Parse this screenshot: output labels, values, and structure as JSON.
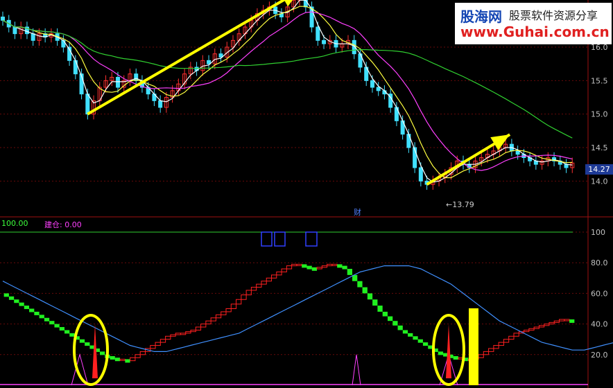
{
  "watermark": {
    "logo": "股海网",
    "tagline": "股票软件资源分享",
    "url": "www.Guhai.com.cn"
  },
  "price_axis": {
    "ticks": [
      "16.0",
      "15.5",
      "15.0",
      "14.5",
      "14.0"
    ],
    "last_price": "14.27"
  },
  "indicator_axis": {
    "ticks": [
      "100",
      "80.0",
      "60.0",
      "40.0",
      "20.0"
    ]
  },
  "labels": {
    "line_a": "100.00",
    "line_b_name": "建仓",
    "line_b_value": "0.00",
    "finance_marker": "财",
    "low_marker": "←13.79"
  },
  "colors": {
    "background": "#000000",
    "candle_up": "#ff3030",
    "candle_down": "#40e0ff",
    "ma_short": "#ffffff",
    "ma_mid": "#ffff40",
    "ma_long": "#ff40ff",
    "ma_trend": "#30d030",
    "arrow": "#ffff00",
    "step_up": "#ff2020",
    "step_down": "#20f020",
    "signal": "#4090ff"
  },
  "chart_data": [
    {
      "type": "candlestick",
      "panel": "price",
      "ylim": [
        13.6,
        16.6
      ],
      "close": [
        16.4,
        16.3,
        16.2,
        16.3,
        16.2,
        16.1,
        16.2,
        16.15,
        16.2,
        16.1,
        16.0,
        15.8,
        15.6,
        15.3,
        15.0,
        15.2,
        15.4,
        15.5,
        15.55,
        15.4,
        15.5,
        15.6,
        15.5,
        15.4,
        15.3,
        15.2,
        15.1,
        15.25,
        15.35,
        15.45,
        15.6,
        15.7,
        15.65,
        15.8,
        15.75,
        15.9,
        15.85,
        16.0,
        16.1,
        16.2,
        16.3,
        16.4,
        16.5,
        16.55,
        16.6,
        16.5,
        16.45,
        16.6,
        16.7,
        16.8,
        16.6,
        16.3,
        16.1,
        16.05,
        16.1,
        16.0,
        16.05,
        16.1,
        15.9,
        15.7,
        15.5,
        15.4,
        15.35,
        15.3,
        15.1,
        14.9,
        14.7,
        14.5,
        14.2,
        14.0,
        13.95,
        14.0,
        14.05,
        14.1,
        14.2,
        14.3,
        14.25,
        14.2,
        14.3,
        14.35,
        14.4,
        14.45,
        14.5,
        14.55,
        14.45,
        14.4,
        14.35,
        14.3,
        14.25,
        14.3,
        14.35,
        14.3,
        14.25,
        14.2,
        14.27
      ],
      "low": 13.79
    },
    {
      "type": "line",
      "panel": "indicator",
      "ylim": [
        0,
        100
      ],
      "series": [
        {
          "values": [
            60,
            58,
            56,
            54,
            52,
            50,
            48,
            46,
            44,
            42,
            40,
            38,
            36,
            34,
            32,
            30,
            28,
            26,
            24,
            22,
            20,
            19,
            18,
            17,
            17,
            16,
            18,
            20,
            22,
            24,
            26,
            28,
            30,
            32,
            33,
            34,
            34,
            35,
            36,
            38,
            40,
            42,
            44,
            46,
            48,
            50,
            53,
            56,
            59,
            62,
            64,
            66,
            68,
            70,
            72,
            74,
            76,
            78,
            79,
            79,
            78,
            77,
            76,
            77,
            78,
            79,
            79,
            78,
            76,
            72,
            68,
            64,
            60,
            56,
            52,
            48,
            45,
            42,
            39,
            36,
            34,
            32,
            30,
            28,
            26,
            24,
            22,
            21,
            20,
            19,
            18,
            18,
            17,
            17,
            18,
            20,
            22,
            24,
            26,
            28,
            30,
            32,
            34,
            35,
            36,
            37,
            38,
            39,
            40,
            41,
            42,
            43,
            43,
            42
          ]
        },
        {
          "values": [
            68,
            66,
            64,
            62,
            60,
            58,
            56,
            54,
            52,
            50,
            48,
            46,
            44,
            42,
            40,
            38,
            36,
            34,
            32,
            30,
            28,
            26,
            25,
            24,
            23,
            22,
            22,
            22,
            23,
            24,
            25,
            26,
            27,
            28,
            29,
            30,
            31,
            32,
            33,
            34,
            36,
            38,
            40,
            42,
            44,
            46,
            48,
            50,
            52,
            54,
            56,
            58,
            60,
            62,
            64,
            66,
            68,
            70,
            72,
            74,
            75,
            76,
            77,
            78,
            78,
            78,
            78,
            78,
            77,
            76,
            74,
            72,
            70,
            68,
            66,
            63,
            60,
            57,
            54,
            51,
            48,
            45,
            42,
            40,
            38,
            36,
            34,
            32,
            30,
            28,
            27,
            26,
            25,
            24,
            23,
            23,
            23,
            24,
            25,
            26,
            27,
            28,
            29,
            30,
            31,
            32,
            33,
            34,
            35,
            36,
            37,
            38,
            39,
            40,
            40
          ]
        }
      ]
    }
  ]
}
